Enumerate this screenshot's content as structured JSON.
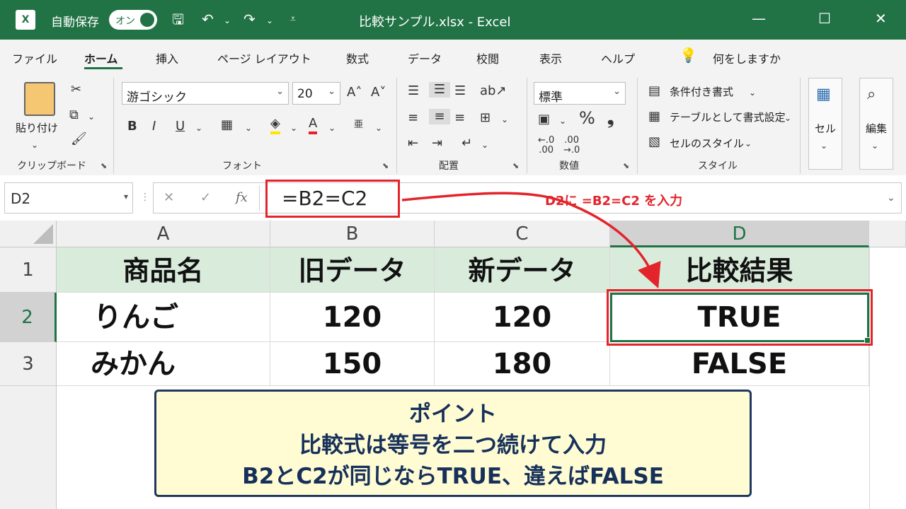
{
  "titlebar": {
    "autosave_label": "自動保存",
    "autosave_state": "オン",
    "title": "比較サンプル.xlsx  -  Excel"
  },
  "tabs": [
    "ファイル",
    "ホーム",
    "挿入",
    "ページ レイアウト",
    "数式",
    "データ",
    "校閲",
    "表示",
    "ヘルプ"
  ],
  "search_placeholder": "何をしますか",
  "ribbon": {
    "paste_label": "貼り付け",
    "clipboard_group": "クリップボード",
    "font_name": "游ゴシック",
    "font_size": "20",
    "font_group": "フォント",
    "bold": "B",
    "italic": "I",
    "underline": "U",
    "align_group": "配置",
    "number_format": "標準",
    "number_group": "数値",
    "percent": "%",
    "comma": "❟",
    "cond_format": "条件付き書式",
    "table_format": "テーブルとして書式設定",
    "cell_styles": "セルのスタイル",
    "style_group": "スタイル",
    "cells": "セル",
    "editing": "編集"
  },
  "formula_bar": {
    "name_box": "D2",
    "fx": "fx",
    "formula": "=B2=C2"
  },
  "columns": [
    "A",
    "B",
    "C",
    "D"
  ],
  "rows": [
    "1",
    "2",
    "3"
  ],
  "cells": {
    "A1": "商品名",
    "B1": "旧データ",
    "C1": "新データ",
    "D1": "比較結果",
    "A2": "りんご",
    "B2": "120",
    "C2": "120",
    "D2": "TRUE",
    "A3": "みかん",
    "B3": "150",
    "C3": "180",
    "D3": "FALSE"
  },
  "annotation": "D2に =B2=C2 を入力",
  "note": {
    "line1": "ポイント",
    "line2": "比較式は等号を二つ続けて入力",
    "line3": "B2とC2が同じならTRUE、違えばFALSE"
  },
  "colors": {
    "excel_green": "#217346",
    "header_fill": "#d9ecdc",
    "highlight_red": "#e3242b",
    "note_fill": "#fffcd4",
    "note_border": "#1f3860"
  }
}
